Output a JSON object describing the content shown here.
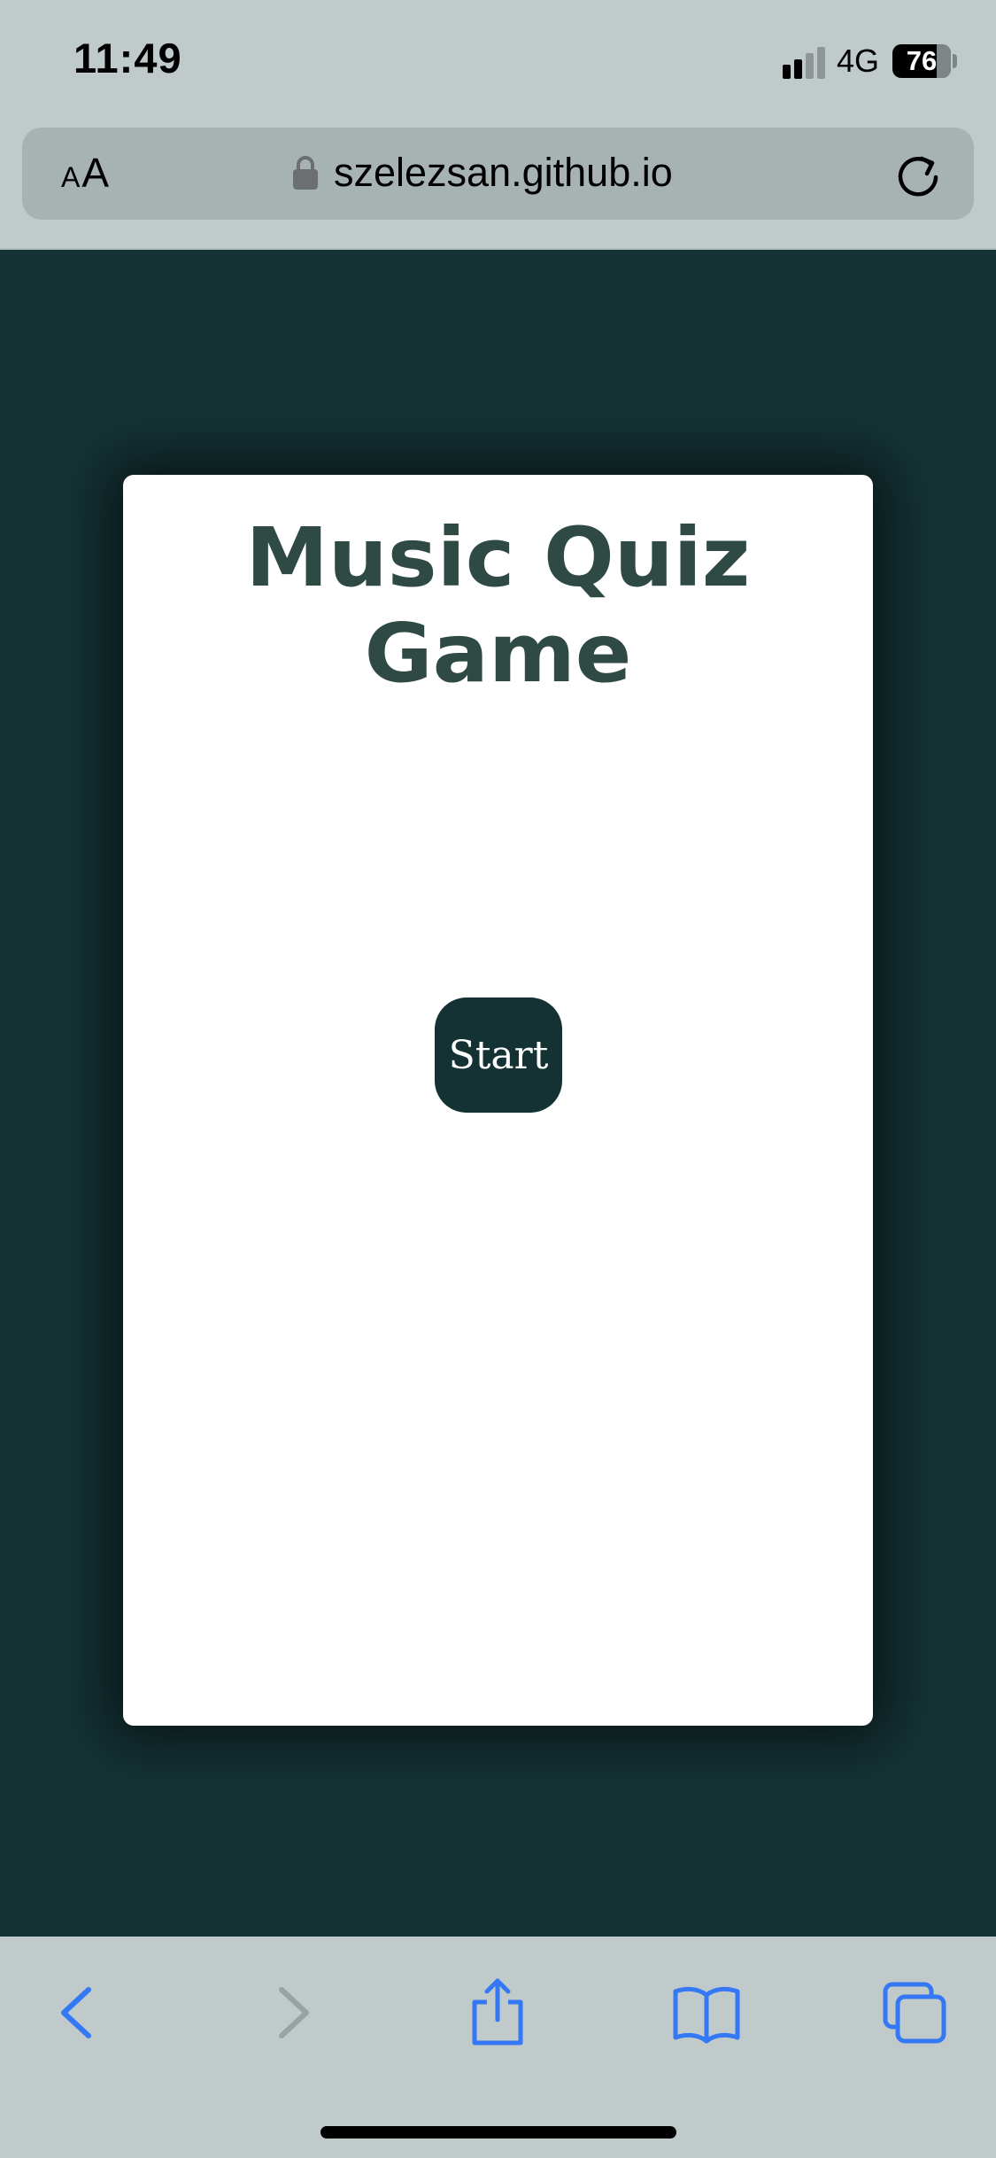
{
  "status_bar": {
    "time": "11:49",
    "network": "4G",
    "battery": "76",
    "signal_icon": "cellular-signal-icon"
  },
  "address_bar": {
    "aa_small": "A",
    "aa_big": "A",
    "url": "szelezsan.github.io",
    "lock_icon": "lock-icon",
    "reload_icon": "reload-icon"
  },
  "page": {
    "title": "Music Quiz Game",
    "start_label": "Start",
    "colors": {
      "background": "#143234",
      "card": "#ffffff",
      "title": "#2f4a44",
      "button": "#143234",
      "button_text": "#ffffff"
    }
  },
  "toolbar": {
    "icons": [
      "back-arrow-icon",
      "forward-arrow-icon",
      "share-icon",
      "bookmarks-icon",
      "tabs-icon"
    ],
    "accent": "#3478f6"
  }
}
